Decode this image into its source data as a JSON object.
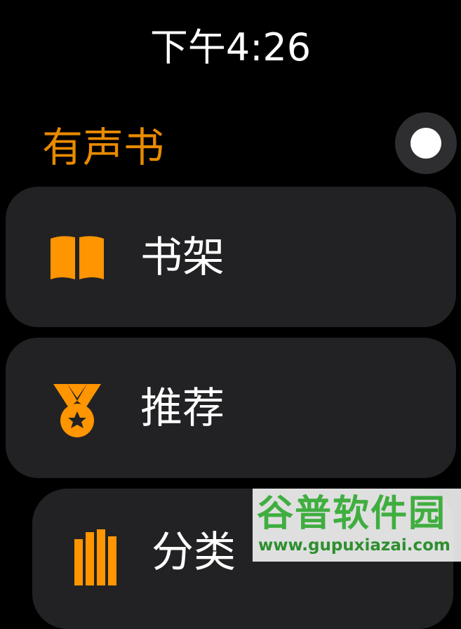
{
  "status_bar": {
    "time": "下午4:26"
  },
  "header": {
    "title": "有声书"
  },
  "menu": {
    "items": [
      {
        "label": "书架",
        "icon": "book-icon"
      },
      {
        "label": "推荐",
        "icon": "medal-icon"
      },
      {
        "label": "分类",
        "icon": "category-bars-icon"
      }
    ]
  },
  "watermark": {
    "title": "谷普软件园",
    "url": "www.gupuxiazai.com"
  },
  "colors": {
    "accent": "#e98a00",
    "icon_orange": "#ff9500",
    "card_bg": "#222224",
    "background": "#000000"
  }
}
